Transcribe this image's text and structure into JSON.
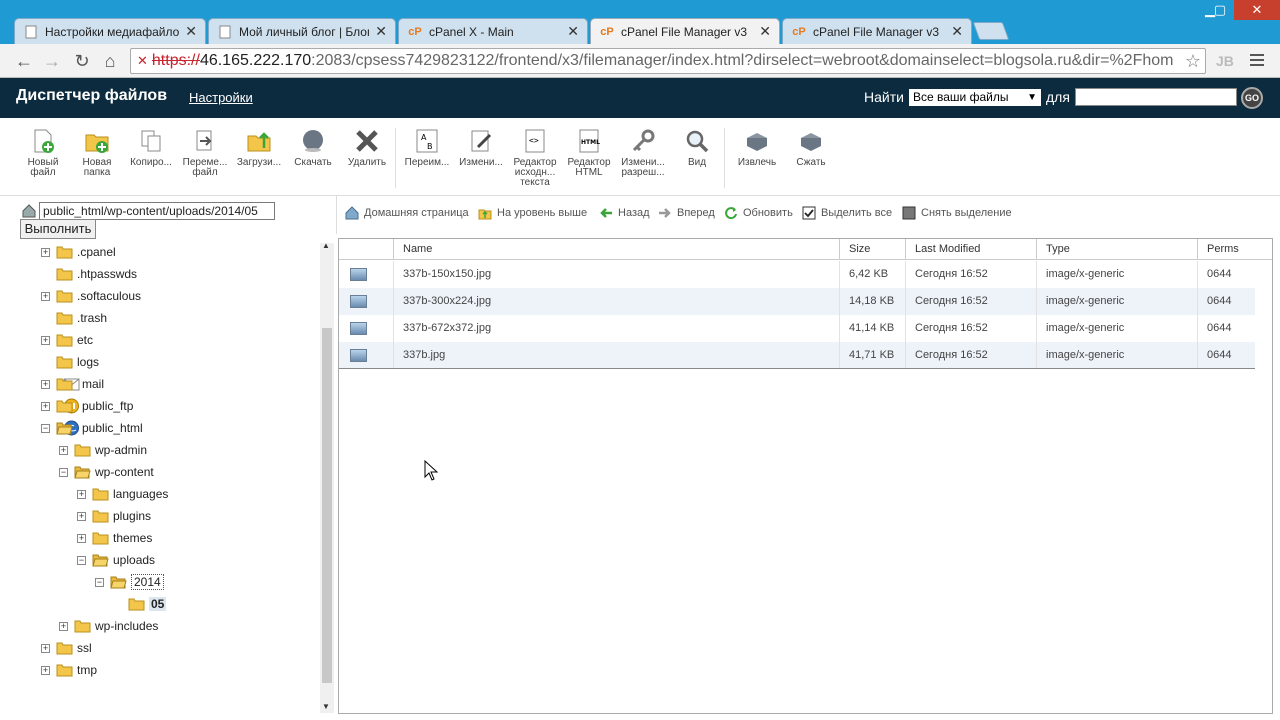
{
  "browser": {
    "tabs": [
      {
        "title": "Настройки медиафайлов",
        "icon": "wordpress-icon",
        "active": false
      },
      {
        "title": "Мой личный блог | Блог",
        "icon": "page-icon",
        "active": false
      },
      {
        "title": "cPanel X - Main",
        "icon": "cpanel-icon",
        "active": false
      },
      {
        "title": "cPanel File Manager v3",
        "icon": "cpanel-icon",
        "active": true
      },
      {
        "title": "cPanel File Manager v3",
        "icon": "cpanel-icon",
        "active": false
      }
    ],
    "url_proto": "https://",
    "url_host": "46.165.222.170",
    "url_rest": ":2083/cpsess7429823122/frontend/x3/filemanager/index.html?dirselect=webroot&domainselect=blogsola.ru&dir=%2Fhom",
    "ext_label": "JB"
  },
  "header": {
    "title": "Диспетчер файлов",
    "settings": "Настройки",
    "find_label": "Найти",
    "find_scope": "Все ваши файлы",
    "for_label": "для",
    "go": "GO"
  },
  "actions": {
    "new_file": "Новый файл",
    "new_folder": "Новая папка",
    "copy": "Копиро...",
    "move": "Переме... файл",
    "upload": "Загрузи...",
    "download": "Скачать",
    "delete": "Удалить",
    "rename": "Переим...",
    "edit": "Измени...",
    "code_editor": "Редактор исходн... текста",
    "html_editor": "Редактор HTML",
    "permissions": "Измени... разреш...",
    "view": "Вид",
    "extract": "Извлечь",
    "compress": "Сжать"
  },
  "left": {
    "path": "public_html/wp-content/uploads/2014/05",
    "go_button": "Выполнить",
    "tree": [
      {
        "label": ".cpanel",
        "level": 0,
        "toggle": "+"
      },
      {
        "label": ".htpasswds",
        "level": 0,
        "toggle": ""
      },
      {
        "label": ".softaculous",
        "level": 0,
        "toggle": "+"
      },
      {
        "label": ".trash",
        "level": 0,
        "toggle": ""
      },
      {
        "label": "etc",
        "level": 0,
        "toggle": "+"
      },
      {
        "label": "logs",
        "level": 0,
        "toggle": ""
      },
      {
        "label": "mail",
        "level": 0,
        "toggle": "+",
        "extra": "mail-icon"
      },
      {
        "label": "public_ftp",
        "level": 0,
        "toggle": "+",
        "extra": "ftp-icon"
      },
      {
        "label": "public_html",
        "level": 0,
        "toggle": "-",
        "extra": "globe-icon",
        "open": true
      },
      {
        "label": "wp-admin",
        "level": 1,
        "toggle": "+"
      },
      {
        "label": "wp-content",
        "level": 1,
        "toggle": "-",
        "open": true
      },
      {
        "label": "languages",
        "level": 2,
        "toggle": "+"
      },
      {
        "label": "plugins",
        "level": 2,
        "toggle": "+"
      },
      {
        "label": "themes",
        "level": 2,
        "toggle": "+"
      },
      {
        "label": "uploads",
        "level": 2,
        "toggle": "-",
        "open": true
      },
      {
        "label": "2014",
        "level": 3,
        "toggle": "-",
        "open": true,
        "focus": true
      },
      {
        "label": "05",
        "level": 4,
        "toggle": "",
        "selected": true
      },
      {
        "label": "wp-includes",
        "level": 1,
        "toggle": "+"
      },
      {
        "label": "ssl",
        "level": 0,
        "toggle": "+"
      },
      {
        "label": "tmp",
        "level": 0,
        "toggle": "+"
      }
    ]
  },
  "nav": {
    "home": "Домашняя страница",
    "up": "На уровень выше",
    "back": "Назад",
    "forward": "Вперед",
    "refresh": "Обновить",
    "select_all": "Выделить все",
    "deselect": "Снять выделение"
  },
  "table": {
    "headers": {
      "name": "Name",
      "size": "Size",
      "modified": "Last Modified",
      "type": "Type",
      "perms": "Perms"
    },
    "rows": [
      {
        "name": "337b-150x150.jpg",
        "size": "6,42 KB",
        "modified": "Сегодня 16:52",
        "type": "image/x-generic",
        "perms": "0644"
      },
      {
        "name": "337b-300x224.jpg",
        "size": "14,18 KB",
        "modified": "Сегодня 16:52",
        "type": "image/x-generic",
        "perms": "0644"
      },
      {
        "name": "337b-672x372.jpg",
        "size": "41,14 KB",
        "modified": "Сегодня 16:52",
        "type": "image/x-generic",
        "perms": "0644"
      },
      {
        "name": "337b.jpg",
        "size": "41,71 KB",
        "modified": "Сегодня 16:52",
        "type": "image/x-generic",
        "perms": "0644"
      }
    ]
  },
  "colors": {
    "chrome": "#1f9ad3",
    "header_bg": "#0c2b3e",
    "row_alt": "#eef3fa"
  }
}
